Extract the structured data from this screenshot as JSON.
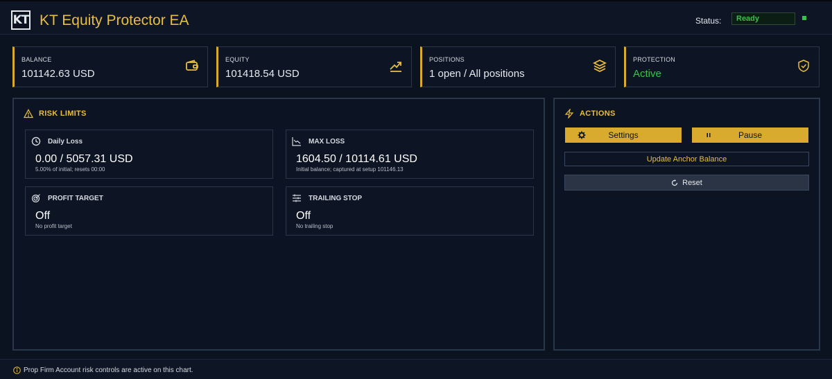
{
  "app": {
    "logo_text": "KT",
    "title": "KT Equity Protector EA",
    "status_label": "Status:",
    "status_value": "Ready",
    "status_color": "#37c34a",
    "accent_color": "#d8ab2e"
  },
  "stats": [
    {
      "label": "BALANCE",
      "value": "101142.63 USD",
      "icon": "wallet-icon"
    },
    {
      "label": "EQUITY",
      "value": "101418.54 USD",
      "icon": "trending-up-icon"
    },
    {
      "label": "POSITIONS",
      "value": "1 open / All positions",
      "icon": "layers-icon"
    },
    {
      "label": "PROTECTION",
      "value": "Active",
      "icon": "shield-check-icon"
    }
  ],
  "risk": {
    "heading": "RISK LIMITS",
    "heading_icon": "warning-triangle-icon",
    "daily_loss": {
      "title": "Daily Loss",
      "value": "0.00 / 5057.31 USD",
      "note": "5.00% of initial; resets 00:00",
      "icon": "clock-icon"
    },
    "max_loss": {
      "title": "MAX LOSS",
      "value": "1604.50 / 10114.61 USD",
      "note": "Initial balance; captured at setup 101146.13",
      "icon": "trending-down-icon"
    },
    "profit_target": {
      "title": "PROFIT TARGET",
      "value": "Off",
      "note": "No profit target",
      "icon": "target-icon"
    },
    "trailing_stop": {
      "title": "TRAILING STOP",
      "value": "Off",
      "note": "No trailing stop",
      "icon": "sliders-icon"
    }
  },
  "actions": {
    "heading": "ACTIONS",
    "heading_icon": "lightning-icon",
    "settings_label": "Settings",
    "pause_label": "Pause",
    "update_anchor_label": "Update Anchor Balance",
    "reset_label": "Reset"
  },
  "footer": {
    "message": "Prop Firm Account risk controls are active on this chart.",
    "icon": "info-icon"
  }
}
